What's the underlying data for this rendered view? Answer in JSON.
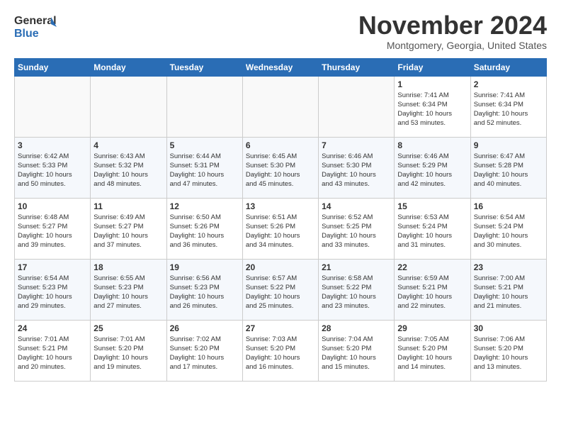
{
  "header": {
    "logo_general": "General",
    "logo_blue": "Blue",
    "month_title": "November 2024",
    "location": "Montgomery, Georgia, United States"
  },
  "days_of_week": [
    "Sunday",
    "Monday",
    "Tuesday",
    "Wednesday",
    "Thursday",
    "Friday",
    "Saturday"
  ],
  "weeks": [
    [
      {
        "day": "",
        "info": ""
      },
      {
        "day": "",
        "info": ""
      },
      {
        "day": "",
        "info": ""
      },
      {
        "day": "",
        "info": ""
      },
      {
        "day": "",
        "info": ""
      },
      {
        "day": "1",
        "info": "Sunrise: 7:41 AM\nSunset: 6:34 PM\nDaylight: 10 hours\nand 53 minutes."
      },
      {
        "day": "2",
        "info": "Sunrise: 7:41 AM\nSunset: 6:34 PM\nDaylight: 10 hours\nand 52 minutes."
      }
    ],
    [
      {
        "day": "3",
        "info": "Sunrise: 6:42 AM\nSunset: 5:33 PM\nDaylight: 10 hours\nand 50 minutes."
      },
      {
        "day": "4",
        "info": "Sunrise: 6:43 AM\nSunset: 5:32 PM\nDaylight: 10 hours\nand 48 minutes."
      },
      {
        "day": "5",
        "info": "Sunrise: 6:44 AM\nSunset: 5:31 PM\nDaylight: 10 hours\nand 47 minutes."
      },
      {
        "day": "6",
        "info": "Sunrise: 6:45 AM\nSunset: 5:30 PM\nDaylight: 10 hours\nand 45 minutes."
      },
      {
        "day": "7",
        "info": "Sunrise: 6:46 AM\nSunset: 5:30 PM\nDaylight: 10 hours\nand 43 minutes."
      },
      {
        "day": "8",
        "info": "Sunrise: 6:46 AM\nSunset: 5:29 PM\nDaylight: 10 hours\nand 42 minutes."
      },
      {
        "day": "9",
        "info": "Sunrise: 6:47 AM\nSunset: 5:28 PM\nDaylight: 10 hours\nand 40 minutes."
      }
    ],
    [
      {
        "day": "10",
        "info": "Sunrise: 6:48 AM\nSunset: 5:27 PM\nDaylight: 10 hours\nand 39 minutes."
      },
      {
        "day": "11",
        "info": "Sunrise: 6:49 AM\nSunset: 5:27 PM\nDaylight: 10 hours\nand 37 minutes."
      },
      {
        "day": "12",
        "info": "Sunrise: 6:50 AM\nSunset: 5:26 PM\nDaylight: 10 hours\nand 36 minutes."
      },
      {
        "day": "13",
        "info": "Sunrise: 6:51 AM\nSunset: 5:26 PM\nDaylight: 10 hours\nand 34 minutes."
      },
      {
        "day": "14",
        "info": "Sunrise: 6:52 AM\nSunset: 5:25 PM\nDaylight: 10 hours\nand 33 minutes."
      },
      {
        "day": "15",
        "info": "Sunrise: 6:53 AM\nSunset: 5:24 PM\nDaylight: 10 hours\nand 31 minutes."
      },
      {
        "day": "16",
        "info": "Sunrise: 6:54 AM\nSunset: 5:24 PM\nDaylight: 10 hours\nand 30 minutes."
      }
    ],
    [
      {
        "day": "17",
        "info": "Sunrise: 6:54 AM\nSunset: 5:23 PM\nDaylight: 10 hours\nand 29 minutes."
      },
      {
        "day": "18",
        "info": "Sunrise: 6:55 AM\nSunset: 5:23 PM\nDaylight: 10 hours\nand 27 minutes."
      },
      {
        "day": "19",
        "info": "Sunrise: 6:56 AM\nSunset: 5:23 PM\nDaylight: 10 hours\nand 26 minutes."
      },
      {
        "day": "20",
        "info": "Sunrise: 6:57 AM\nSunset: 5:22 PM\nDaylight: 10 hours\nand 25 minutes."
      },
      {
        "day": "21",
        "info": "Sunrise: 6:58 AM\nSunset: 5:22 PM\nDaylight: 10 hours\nand 23 minutes."
      },
      {
        "day": "22",
        "info": "Sunrise: 6:59 AM\nSunset: 5:21 PM\nDaylight: 10 hours\nand 22 minutes."
      },
      {
        "day": "23",
        "info": "Sunrise: 7:00 AM\nSunset: 5:21 PM\nDaylight: 10 hours\nand 21 minutes."
      }
    ],
    [
      {
        "day": "24",
        "info": "Sunrise: 7:01 AM\nSunset: 5:21 PM\nDaylight: 10 hours\nand 20 minutes."
      },
      {
        "day": "25",
        "info": "Sunrise: 7:01 AM\nSunset: 5:20 PM\nDaylight: 10 hours\nand 19 minutes."
      },
      {
        "day": "26",
        "info": "Sunrise: 7:02 AM\nSunset: 5:20 PM\nDaylight: 10 hours\nand 17 minutes."
      },
      {
        "day": "27",
        "info": "Sunrise: 7:03 AM\nSunset: 5:20 PM\nDaylight: 10 hours\nand 16 minutes."
      },
      {
        "day": "28",
        "info": "Sunrise: 7:04 AM\nSunset: 5:20 PM\nDaylight: 10 hours\nand 15 minutes."
      },
      {
        "day": "29",
        "info": "Sunrise: 7:05 AM\nSunset: 5:20 PM\nDaylight: 10 hours\nand 14 minutes."
      },
      {
        "day": "30",
        "info": "Sunrise: 7:06 AM\nSunset: 5:20 PM\nDaylight: 10 hours\nand 13 minutes."
      }
    ]
  ]
}
